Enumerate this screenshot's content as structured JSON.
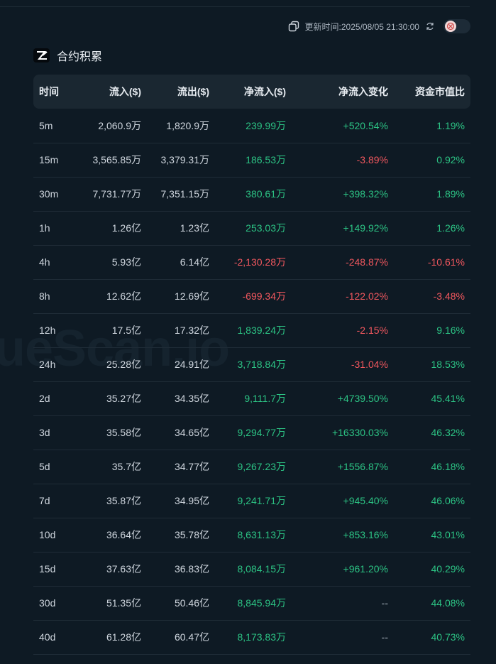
{
  "watermark": "ueScan.io",
  "header": {
    "update_label": "更新时间:2025/08/05 21:30:00",
    "icons": [
      "copy-icon",
      "refresh-icon",
      "toggle-switch"
    ]
  },
  "section": {
    "title": "合约积累",
    "logo_icon": "exchange-logo-icon"
  },
  "table": {
    "columns": [
      "时间",
      "流入($)",
      "流出($)",
      "净流入($)",
      "净流入变化",
      "资金市值比"
    ],
    "rows": [
      {
        "time": "5m",
        "inflow": "2,060.9万",
        "outflow": "1,820.9万",
        "net": "239.99万",
        "net_sign": "pos",
        "change": "+520.54%",
        "change_sign": "pos",
        "ratio": "1.19%",
        "ratio_sign": "pos"
      },
      {
        "time": "15m",
        "inflow": "3,565.85万",
        "outflow": "3,379.31万",
        "net": "186.53万",
        "net_sign": "pos",
        "change": "-3.89%",
        "change_sign": "neg",
        "ratio": "0.92%",
        "ratio_sign": "pos"
      },
      {
        "time": "30m",
        "inflow": "7,731.77万",
        "outflow": "7,351.15万",
        "net": "380.61万",
        "net_sign": "pos",
        "change": "+398.32%",
        "change_sign": "pos",
        "ratio": "1.89%",
        "ratio_sign": "pos"
      },
      {
        "time": "1h",
        "inflow": "1.26亿",
        "outflow": "1.23亿",
        "net": "253.03万",
        "net_sign": "pos",
        "change": "+149.92%",
        "change_sign": "pos",
        "ratio": "1.26%",
        "ratio_sign": "pos"
      },
      {
        "time": "4h",
        "inflow": "5.93亿",
        "outflow": "6.14亿",
        "net": "-2,130.28万",
        "net_sign": "neg",
        "change": "-248.87%",
        "change_sign": "neg",
        "ratio": "-10.61%",
        "ratio_sign": "neg"
      },
      {
        "time": "8h",
        "inflow": "12.62亿",
        "outflow": "12.69亿",
        "net": "-699.34万",
        "net_sign": "neg",
        "change": "-122.02%",
        "change_sign": "neg",
        "ratio": "-3.48%",
        "ratio_sign": "neg"
      },
      {
        "time": "12h",
        "inflow": "17.5亿",
        "outflow": "17.32亿",
        "net": "1,839.24万",
        "net_sign": "pos",
        "change": "-2.15%",
        "change_sign": "neg",
        "ratio": "9.16%",
        "ratio_sign": "pos"
      },
      {
        "time": "24h",
        "inflow": "25.28亿",
        "outflow": "24.91亿",
        "net": "3,718.84万",
        "net_sign": "pos",
        "change": "-31.04%",
        "change_sign": "neg",
        "ratio": "18.53%",
        "ratio_sign": "pos"
      },
      {
        "time": "2d",
        "inflow": "35.27亿",
        "outflow": "34.35亿",
        "net": "9,111.7万",
        "net_sign": "pos",
        "change": "+4739.50%",
        "change_sign": "pos",
        "ratio": "45.41%",
        "ratio_sign": "pos"
      },
      {
        "time": "3d",
        "inflow": "35.58亿",
        "outflow": "34.65亿",
        "net": "9,294.77万",
        "net_sign": "pos",
        "change": "+16330.03%",
        "change_sign": "pos",
        "ratio": "46.32%",
        "ratio_sign": "pos"
      },
      {
        "time": "5d",
        "inflow": "35.7亿",
        "outflow": "34.77亿",
        "net": "9,267.23万",
        "net_sign": "pos",
        "change": "+1556.87%",
        "change_sign": "pos",
        "ratio": "46.18%",
        "ratio_sign": "pos"
      },
      {
        "time": "7d",
        "inflow": "35.87亿",
        "outflow": "34.95亿",
        "net": "9,241.71万",
        "net_sign": "pos",
        "change": "+945.40%",
        "change_sign": "pos",
        "ratio": "46.06%",
        "ratio_sign": "pos"
      },
      {
        "time": "10d",
        "inflow": "36.64亿",
        "outflow": "35.78亿",
        "net": "8,631.13万",
        "net_sign": "pos",
        "change": "+853.16%",
        "change_sign": "pos",
        "ratio": "43.01%",
        "ratio_sign": "pos"
      },
      {
        "time": "15d",
        "inflow": "37.63亿",
        "outflow": "36.83亿",
        "net": "8,084.15万",
        "net_sign": "pos",
        "change": "+961.20%",
        "change_sign": "pos",
        "ratio": "40.29%",
        "ratio_sign": "pos"
      },
      {
        "time": "30d",
        "inflow": "51.35亿",
        "outflow": "50.46亿",
        "net": "8,845.94万",
        "net_sign": "pos",
        "change": "--",
        "change_sign": "neu",
        "ratio": "44.08%",
        "ratio_sign": "pos"
      },
      {
        "time": "40d",
        "inflow": "61.28亿",
        "outflow": "60.47亿",
        "net": "8,173.83万",
        "net_sign": "pos",
        "change": "--",
        "change_sign": "neu",
        "ratio": "40.73%",
        "ratio_sign": "pos"
      }
    ]
  },
  "colors": {
    "background": "#0e1a24",
    "header_row": "#1a2731",
    "positive": "#2cc384",
    "negative": "#f0575e"
  }
}
